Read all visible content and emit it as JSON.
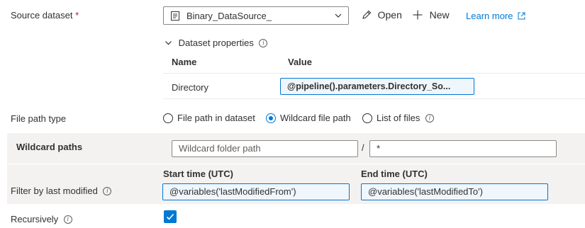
{
  "source_dataset": {
    "label": "Source dataset",
    "required_mark": "*",
    "selected": "Binary_DataSource_",
    "open_label": "Open",
    "new_label": "New",
    "learn_more_label": "Learn more"
  },
  "dataset_properties": {
    "header": "Dataset properties",
    "columns": {
      "name": "Name",
      "value": "Value"
    },
    "rows": [
      {
        "name": "Directory",
        "value": "@pipeline().parameters.Directory_So..."
      }
    ]
  },
  "file_path_type": {
    "label": "File path type",
    "options": [
      "File path in dataset",
      "Wildcard file path",
      "List of files"
    ],
    "selected": "Wildcard file path"
  },
  "wildcard_paths": {
    "label": "Wildcard paths",
    "folder_placeholder": "Wildcard folder path",
    "separator": "/",
    "file_value": "*"
  },
  "filter_last_modified": {
    "label": "Filter by last modified",
    "start_label": "Start time (UTC)",
    "end_label": "End time (UTC)",
    "start_value": "@variables('lastModifiedFrom')",
    "end_value": "@variables('lastModifiedTo')"
  },
  "recursively": {
    "label": "Recursively",
    "checked": true
  },
  "colors": {
    "accent": "#0078d4",
    "link": "#0078d4",
    "required": "#a4262c",
    "band": "#f3f2f1"
  }
}
